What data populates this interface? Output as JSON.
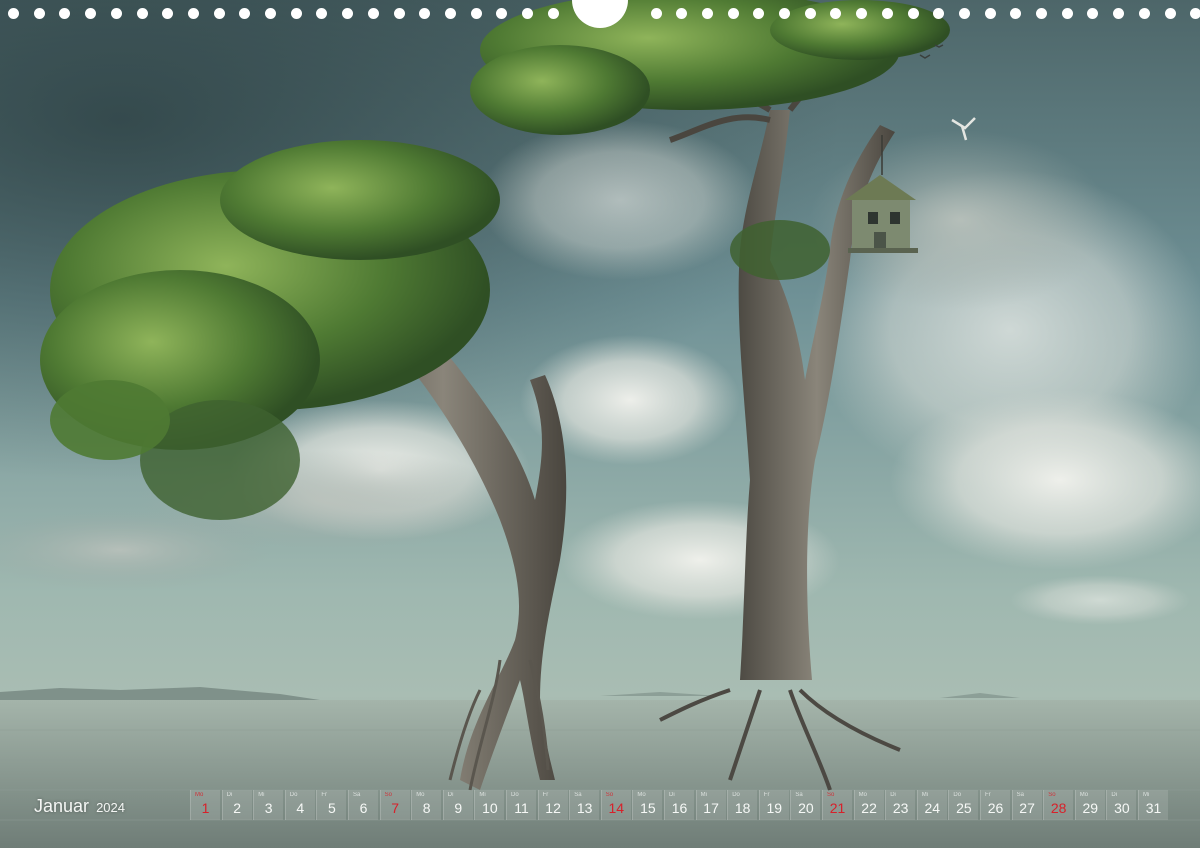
{
  "calendar": {
    "month": "Januar",
    "year": "2024",
    "days": [
      {
        "wd": "Mo",
        "d": "1",
        "sun": true
      },
      {
        "wd": "Di",
        "d": "2"
      },
      {
        "wd": "Mi",
        "d": "3"
      },
      {
        "wd": "Do",
        "d": "4"
      },
      {
        "wd": "Fr",
        "d": "5"
      },
      {
        "wd": "Sa",
        "d": "6"
      },
      {
        "wd": "So",
        "d": "7",
        "sun": true
      },
      {
        "wd": "Mo",
        "d": "8"
      },
      {
        "wd": "Di",
        "d": "9"
      },
      {
        "wd": "Mi",
        "d": "10"
      },
      {
        "wd": "Do",
        "d": "11"
      },
      {
        "wd": "Fr",
        "d": "12"
      },
      {
        "wd": "Sa",
        "d": "13"
      },
      {
        "wd": "So",
        "d": "14",
        "sun": true
      },
      {
        "wd": "Mo",
        "d": "15"
      },
      {
        "wd": "Di",
        "d": "16"
      },
      {
        "wd": "Mi",
        "d": "17"
      },
      {
        "wd": "Do",
        "d": "18"
      },
      {
        "wd": "Fr",
        "d": "19"
      },
      {
        "wd": "Sa",
        "d": "20"
      },
      {
        "wd": "So",
        "d": "21",
        "sun": true
      },
      {
        "wd": "Mo",
        "d": "22"
      },
      {
        "wd": "Di",
        "d": "23"
      },
      {
        "wd": "Mi",
        "d": "24"
      },
      {
        "wd": "Do",
        "d": "25"
      },
      {
        "wd": "Fr",
        "d": "26"
      },
      {
        "wd": "Sa",
        "d": "27"
      },
      {
        "wd": "So",
        "d": "28",
        "sun": true
      },
      {
        "wd": "Mo",
        "d": "29"
      },
      {
        "wd": "Di",
        "d": "30"
      },
      {
        "wd": "Mi",
        "d": "31"
      }
    ]
  },
  "colors": {
    "sunday": "#d8202a",
    "text": "#f6f8f6"
  }
}
